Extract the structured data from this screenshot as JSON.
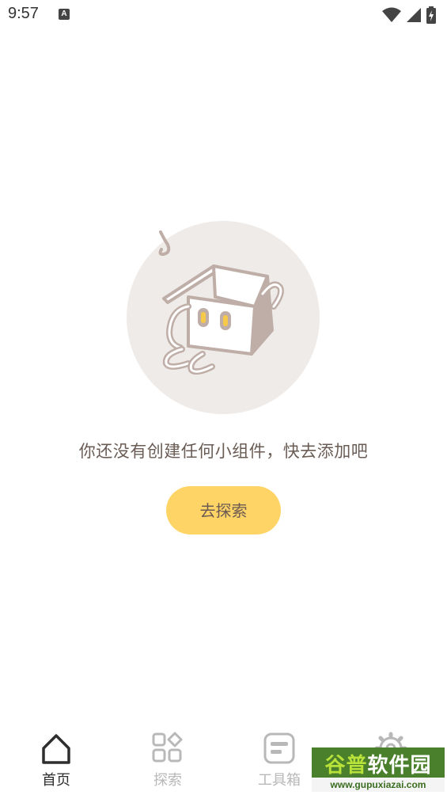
{
  "status_bar": {
    "time": "9:57",
    "notification_icon": "a-letter-icon",
    "wifi_icon": "wifi-icon",
    "signal_icon": "cell-signal-icon",
    "battery_icon": "battery-charging-icon"
  },
  "empty_state": {
    "illustration_icon": "confused-box-character-icon",
    "message": "你还没有创建任何小组件，快去添加吧",
    "button_label": "去探索"
  },
  "bottom_nav": {
    "items": [
      {
        "label": "首页",
        "icon": "home-icon",
        "active": true
      },
      {
        "label": "探索",
        "icon": "grid-apps-icon",
        "active": false
      },
      {
        "label": "工具箱",
        "icon": "toolbox-icon",
        "active": false
      },
      {
        "label": "",
        "icon": "gear-icon",
        "active": false
      }
    ]
  },
  "watermark": {
    "title_part1": "谷普",
    "title_part2": "软件园",
    "url": "www.gupuxiazai.com"
  },
  "colors": {
    "accent_button": "#ffd466",
    "text_primary": "#6a5c55",
    "nav_active": "#2e2e2e",
    "nav_inactive": "#b8b8b8",
    "illustration_bg": "#efebe8",
    "illustration_stroke": "#bfaea7",
    "eye_yellow": "#f7c948"
  }
}
